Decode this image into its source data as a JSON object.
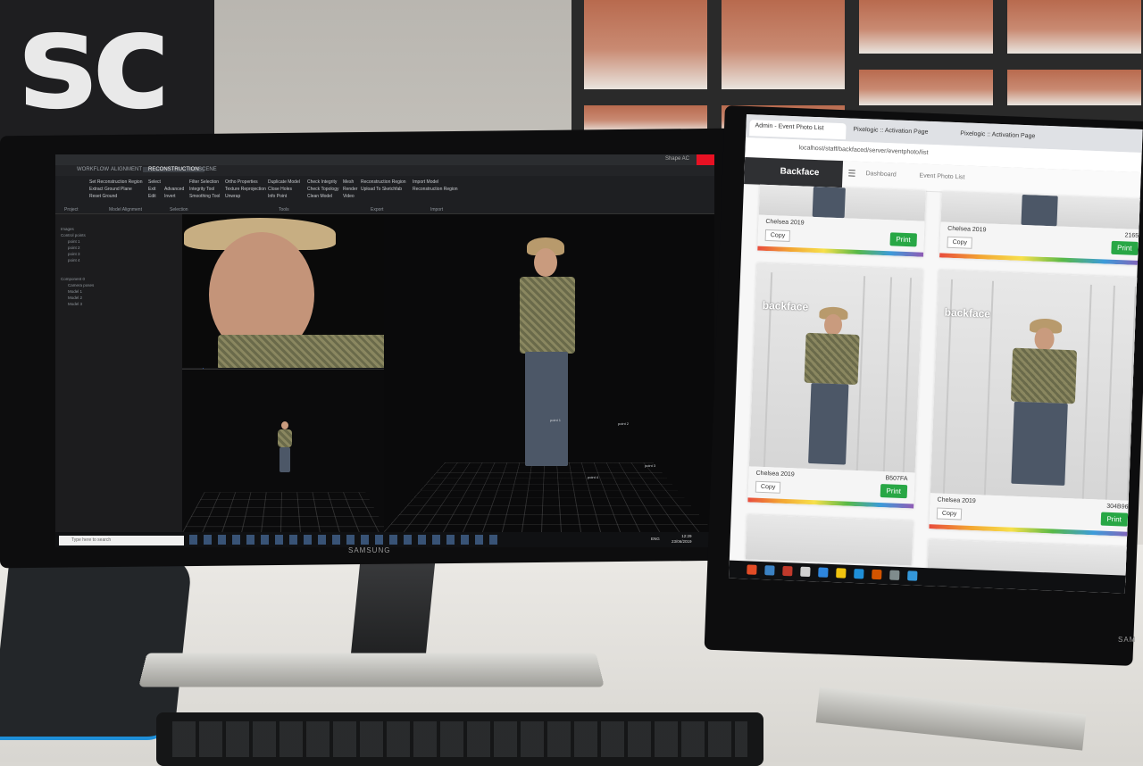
{
  "scene": {
    "left_monitor_brand": "SAMSUNG",
    "right_monitor_brand": "SAM"
  },
  "app": {
    "title": "Shape AC",
    "tabs": [
      "WORKFLOW",
      "ALIGNMENT",
      "RECONSTRUCTION",
      "SCENE"
    ],
    "active_tab": "RECONSTRUCTION",
    "ribbon_items": [
      "Set Reconstruction Region",
      "Extract Ground Plane",
      "Reset Ground",
      "Select",
      "Exit",
      "Edit",
      "Advanced",
      "Invert",
      "Filter Selection",
      "Integrity Tool",
      "Smoothing Tool",
      "Ortho Properties",
      "Texture Reprojection",
      "Unwrap",
      "Duplicate Model",
      "Close Holes",
      "Info Point",
      "Check Integrity",
      "Check Topology",
      "Clean Model",
      "Mesh",
      "Render",
      "Video",
      "Reconstruction Region",
      "Upload To Sketchfab",
      "Import Model",
      "Reconstruction Region"
    ],
    "ribbon_groups": [
      "Project",
      "Model Alignment",
      "Selection",
      "Tools",
      "Export",
      "Import"
    ],
    "tree": [
      "Images",
      "Control points",
      "point 1",
      "point 2",
      "point 3",
      "point 4",
      "Component 0",
      "Camera poses",
      "Model 1",
      "Model 2",
      "Model 3"
    ],
    "points": [
      "point 1",
      "point 2",
      "point 3",
      "point 4"
    ],
    "search_placeholder": "Type here to search",
    "clock_time": "12:29",
    "clock_date": "23/06/2019",
    "lang": "ENG"
  },
  "browser": {
    "tabs": [
      "Admin - Event Photo List",
      "Pixelogic :: Activation Page",
      "Pixelogic :: Activation Page"
    ],
    "url": "localhost/staff/backfaced/server/eventphoto/list",
    "brand": "Backface",
    "nav_dashboard": "Dashboard",
    "nav_current": "Event Photo List",
    "cards": [
      {
        "event": "Chelsea 2019",
        "code": "",
        "copy": "Copy",
        "print": "Print"
      },
      {
        "event": "Chelsea 2019",
        "code": "2165",
        "copy": "Copy",
        "print": "Print"
      },
      {
        "event": "Chelsea 2019",
        "code": "B507FA",
        "copy": "Copy",
        "print": "Print"
      },
      {
        "event": "Chelsea 2019",
        "code": "304B96",
        "copy": "Copy",
        "print": "Print"
      }
    ],
    "card_logo": "backface"
  }
}
